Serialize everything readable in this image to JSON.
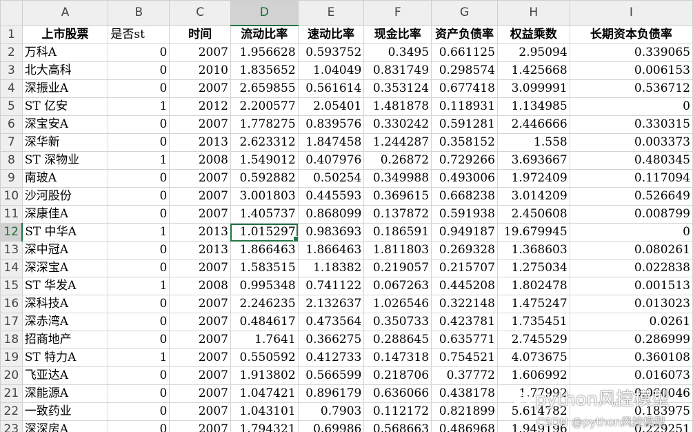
{
  "column_headers": [
    "A",
    "B",
    "C",
    "D",
    "E",
    "F",
    "G",
    "H",
    "I"
  ],
  "selected_column": "D",
  "selected_row": 12,
  "active_cell": "D12",
  "colors": {
    "accent": "#217346",
    "header_bg": "#efefef",
    "selected_header_bg": "#d2d2d2",
    "grid_line": "#d4d4d4"
  },
  "rows": [
    {
      "num": "1",
      "cells": [
        "上市股票",
        "是否st",
        "时间",
        "流动比率",
        "速动比率",
        "现金比率",
        "资产负债率",
        "权益乘数",
        "长期资本负债率"
      ]
    },
    {
      "num": "2",
      "cells": [
        "万科A",
        "0",
        "2007",
        "1.956628",
        "0.593752",
        "0.3495",
        "0.661125",
        "2.95094",
        "0.339065"
      ]
    },
    {
      "num": "3",
      "cells": [
        "北大高科",
        "0",
        "2010",
        "1.835652",
        "1.04049",
        "0.831749",
        "0.298574",
        "1.425668",
        "0.006153"
      ]
    },
    {
      "num": "4",
      "cells": [
        "深振业A",
        "0",
        "2007",
        "2.659855",
        "0.561614",
        "0.353124",
        "0.677418",
        "3.099991",
        "0.536712"
      ]
    },
    {
      "num": "5",
      "cells": [
        "ST 亿安",
        "1",
        "2012",
        "2.200577",
        "2.05401",
        "1.481878",
        "0.118931",
        "1.134985",
        "0"
      ]
    },
    {
      "num": "6",
      "cells": [
        "深宝安A",
        "0",
        "2007",
        "1.778275",
        "0.839576",
        "0.330242",
        "0.591281",
        "2.446666",
        "0.330315"
      ]
    },
    {
      "num": "7",
      "cells": [
        "深华新",
        "0",
        "2013",
        "2.623312",
        "1.847458",
        "1.244287",
        "0.358152",
        "1.558",
        "0.003373"
      ]
    },
    {
      "num": "8",
      "cells": [
        "ST 深物业",
        "1",
        "2008",
        "1.549012",
        "0.407976",
        "0.26872",
        "0.729266",
        "3.693667",
        "0.480345"
      ]
    },
    {
      "num": "9",
      "cells": [
        "南玻A",
        "0",
        "2007",
        "0.592882",
        "0.50254",
        "0.349988",
        "0.493006",
        "1.972409",
        "0.117094"
      ]
    },
    {
      "num": "10",
      "cells": [
        "沙河股份",
        "0",
        "2007",
        "3.001803",
        "0.445593",
        "0.369615",
        "0.668238",
        "3.014209",
        "0.526649"
      ]
    },
    {
      "num": "11",
      "cells": [
        "深康佳A",
        "0",
        "2007",
        "1.405737",
        "0.868099",
        "0.137872",
        "0.591938",
        "2.450608",
        "0.008799"
      ]
    },
    {
      "num": "12",
      "cells": [
        "ST 中华A",
        "1",
        "2013",
        "1.015297",
        "0.983693",
        "0.186591",
        "0.949187",
        "19.679945",
        "0"
      ]
    },
    {
      "num": "13",
      "cells": [
        "深中冠A",
        "0",
        "2013",
        "1.866463",
        "1.866463",
        "1.811803",
        "0.269328",
        "1.368603",
        "0.080261"
      ]
    },
    {
      "num": "14",
      "cells": [
        "深深宝A",
        "0",
        "2007",
        "1.583515",
        "1.18382",
        "0.219057",
        "0.215707",
        "1.275034",
        "0.022838"
      ]
    },
    {
      "num": "15",
      "cells": [
        "ST 华发A",
        "1",
        "2008",
        "0.995348",
        "0.741122",
        "0.067263",
        "0.445208",
        "1.802478",
        "0.001513"
      ]
    },
    {
      "num": "16",
      "cells": [
        "深科技A",
        "0",
        "2007",
        "2.246235",
        "2.132637",
        "1.026546",
        "0.322148",
        "1.475247",
        "0.013023"
      ]
    },
    {
      "num": "17",
      "cells": [
        "深赤湾A",
        "0",
        "2007",
        "0.484617",
        "0.473564",
        "0.350733",
        "0.423781",
        "1.735451",
        "0.0261"
      ]
    },
    {
      "num": "18",
      "cells": [
        "招商地产",
        "0",
        "2007",
        "1.7641",
        "0.366275",
        "0.288645",
        "0.635771",
        "2.745529",
        "0.286999"
      ]
    },
    {
      "num": "19",
      "cells": [
        "ST 特力A",
        "1",
        "2007",
        "0.550592",
        "0.412733",
        "0.147318",
        "0.754521",
        "4.073675",
        "0.360108"
      ]
    },
    {
      "num": "20",
      "cells": [
        "飞亚达A",
        "0",
        "2007",
        "1.913802",
        "0.566599",
        "0.218706",
        "0.37772",
        "1.606992",
        "0.016073"
      ]
    },
    {
      "num": "21",
      "cells": [
        "深能源A",
        "0",
        "2007",
        "1.047421",
        "0.896179",
        "0.636066",
        "0.438178",
        "1.77992",
        "0.060046"
      ]
    },
    {
      "num": "22",
      "cells": [
        "一致药业",
        "0",
        "2007",
        "1.043101",
        "0.7903",
        "0.112172",
        "0.821899",
        "5.614782",
        "0.183975"
      ]
    },
    {
      "num": "23",
      "cells": [
        "深深房A",
        "0",
        "2007",
        "1.794321",
        "0.69986",
        "0.568663",
        "0.486968",
        "1.949196",
        "0.229251"
      ]
    }
  ],
  "watermark": {
    "line1": "python风控模型",
    "line2": "CSDN @python风控模型"
  }
}
